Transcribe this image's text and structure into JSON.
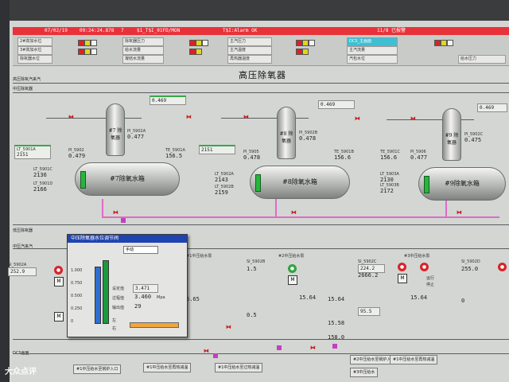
{
  "alarm_bar": {
    "date": "07/02/19",
    "time": "09:24:24.878",
    "seq": "7",
    "tag": "$1_T$I_01FD/MON",
    "status": "T$I:Alarm OK",
    "right": "11/8 已报警"
  },
  "top_panel": {
    "cells": [
      "2#高加水位",
      "3#高加水位",
      "除氧器水位",
      "除氧器压力",
      "给水流量",
      "凝结水流量",
      "主汽压力",
      "主汽温度",
      "再热器温度",
      "主汽流量",
      "汽包水位",
      "给水压力"
    ],
    "link": "DCS_主画面"
  },
  "title": "高压除氧器",
  "left_nav": {
    "a": "高压除氧汽来汽",
    "b": "中压除氧器",
    "c": "低压除氧器",
    "d": "中压汽来汽",
    "e": "DCS画面",
    "f": "中压给水",
    "g": "中压给水"
  },
  "deaerators": [
    {
      "tower_label": "#7\n除氧器",
      "tank_label": "#7除氧水箱",
      "p_tag": "PI_5902A",
      "p_val": "0.477",
      "t_tag": "TE_5901A",
      "t_val": "156.5",
      "l_tag": "LT_5901A",
      "l_val": "2151",
      "pv_tag": "PI_5902",
      "pv_val": "0.479",
      "box_val": "0.469"
    },
    {
      "tower_label": "#8\n除氧器",
      "tank_label": "#8除氧水箱",
      "p_tag": "PI_5902B",
      "p_val": "0.478",
      "t_tag": "TE_5901B",
      "t_val": "156.6",
      "l_tag": "LT_5902A",
      "l_val": "2143",
      "pv_tag": "PI_5905",
      "pv_val": "0.478",
      "box_val": "0.469"
    },
    {
      "tower_label": "#9\n除氧器",
      "tank_label": "#9除氧水箱",
      "p_tag": "PI_5902C",
      "p_val": "0.475",
      "t_tag": "TE_5901C",
      "t_val": "156.6",
      "l_tag": "LT_5903A",
      "l_val": "2130",
      "pv_tag": "PI_5906",
      "pv_val": "0.477",
      "box_val": "0.469"
    }
  ],
  "left_vals": [
    {
      "tag": "LT_5901B",
      "val": "2151"
    },
    {
      "tag": "LT_5901C",
      "val": "2136"
    },
    {
      "tag": "LT_5901D",
      "val": "2166"
    }
  ],
  "mid_vals": [
    {
      "tag": "LT_5902B",
      "val": "2159"
    },
    {
      "tag": "LT_5903B",
      "val": "2172"
    }
  ],
  "pumps": [
    {
      "label": "#1中压给水泵",
      "tag": "SI_5902A",
      "flow": "252.9",
      "current": "6.65"
    },
    {
      "label": "#2中压给水泵",
      "tag": "SI_5902B",
      "flow": "1.5",
      "current": "15.64"
    },
    {
      "label": "#3中压给水泵",
      "tag": "SI_5902C",
      "flow": "224.2",
      "current": "15.64"
    },
    {
      "label": "#4中压给水泵",
      "tag": "SI_5902D",
      "flow": "255.0",
      "current": "0"
    }
  ],
  "pump_extra": {
    "run": "运行",
    "stop": "停止",
    "v1": "2666.2",
    "v2": "15.58",
    "v3": "95.5",
    "v4": "158.0",
    "v5": "0.5"
  },
  "popup": {
    "title": "中压除氧器水位调节阀",
    "mode": "手动",
    "sp_label": "设定值",
    "sp_val": "3.471",
    "pv_label": "过程值",
    "pv_val": "3.460",
    "out_label": "输出值",
    "out_val": "29",
    "unit": "Mpa",
    "left": "左",
    "right": "右",
    "scale": [
      "1.000",
      "0.750",
      "0.500",
      "0.250",
      "0"
    ],
    "bars": [
      0.85,
      0.55
    ]
  },
  "bottom_buttons": [
    "#1中压给水至锅炉入口",
    "#1中压给水至再热减温",
    "#1中压给水至过热减温",
    "#2中压给水至锅炉入口",
    "#1中压给水至再热减温",
    "#3中压给水"
  ],
  "watermark": "大众点评"
}
